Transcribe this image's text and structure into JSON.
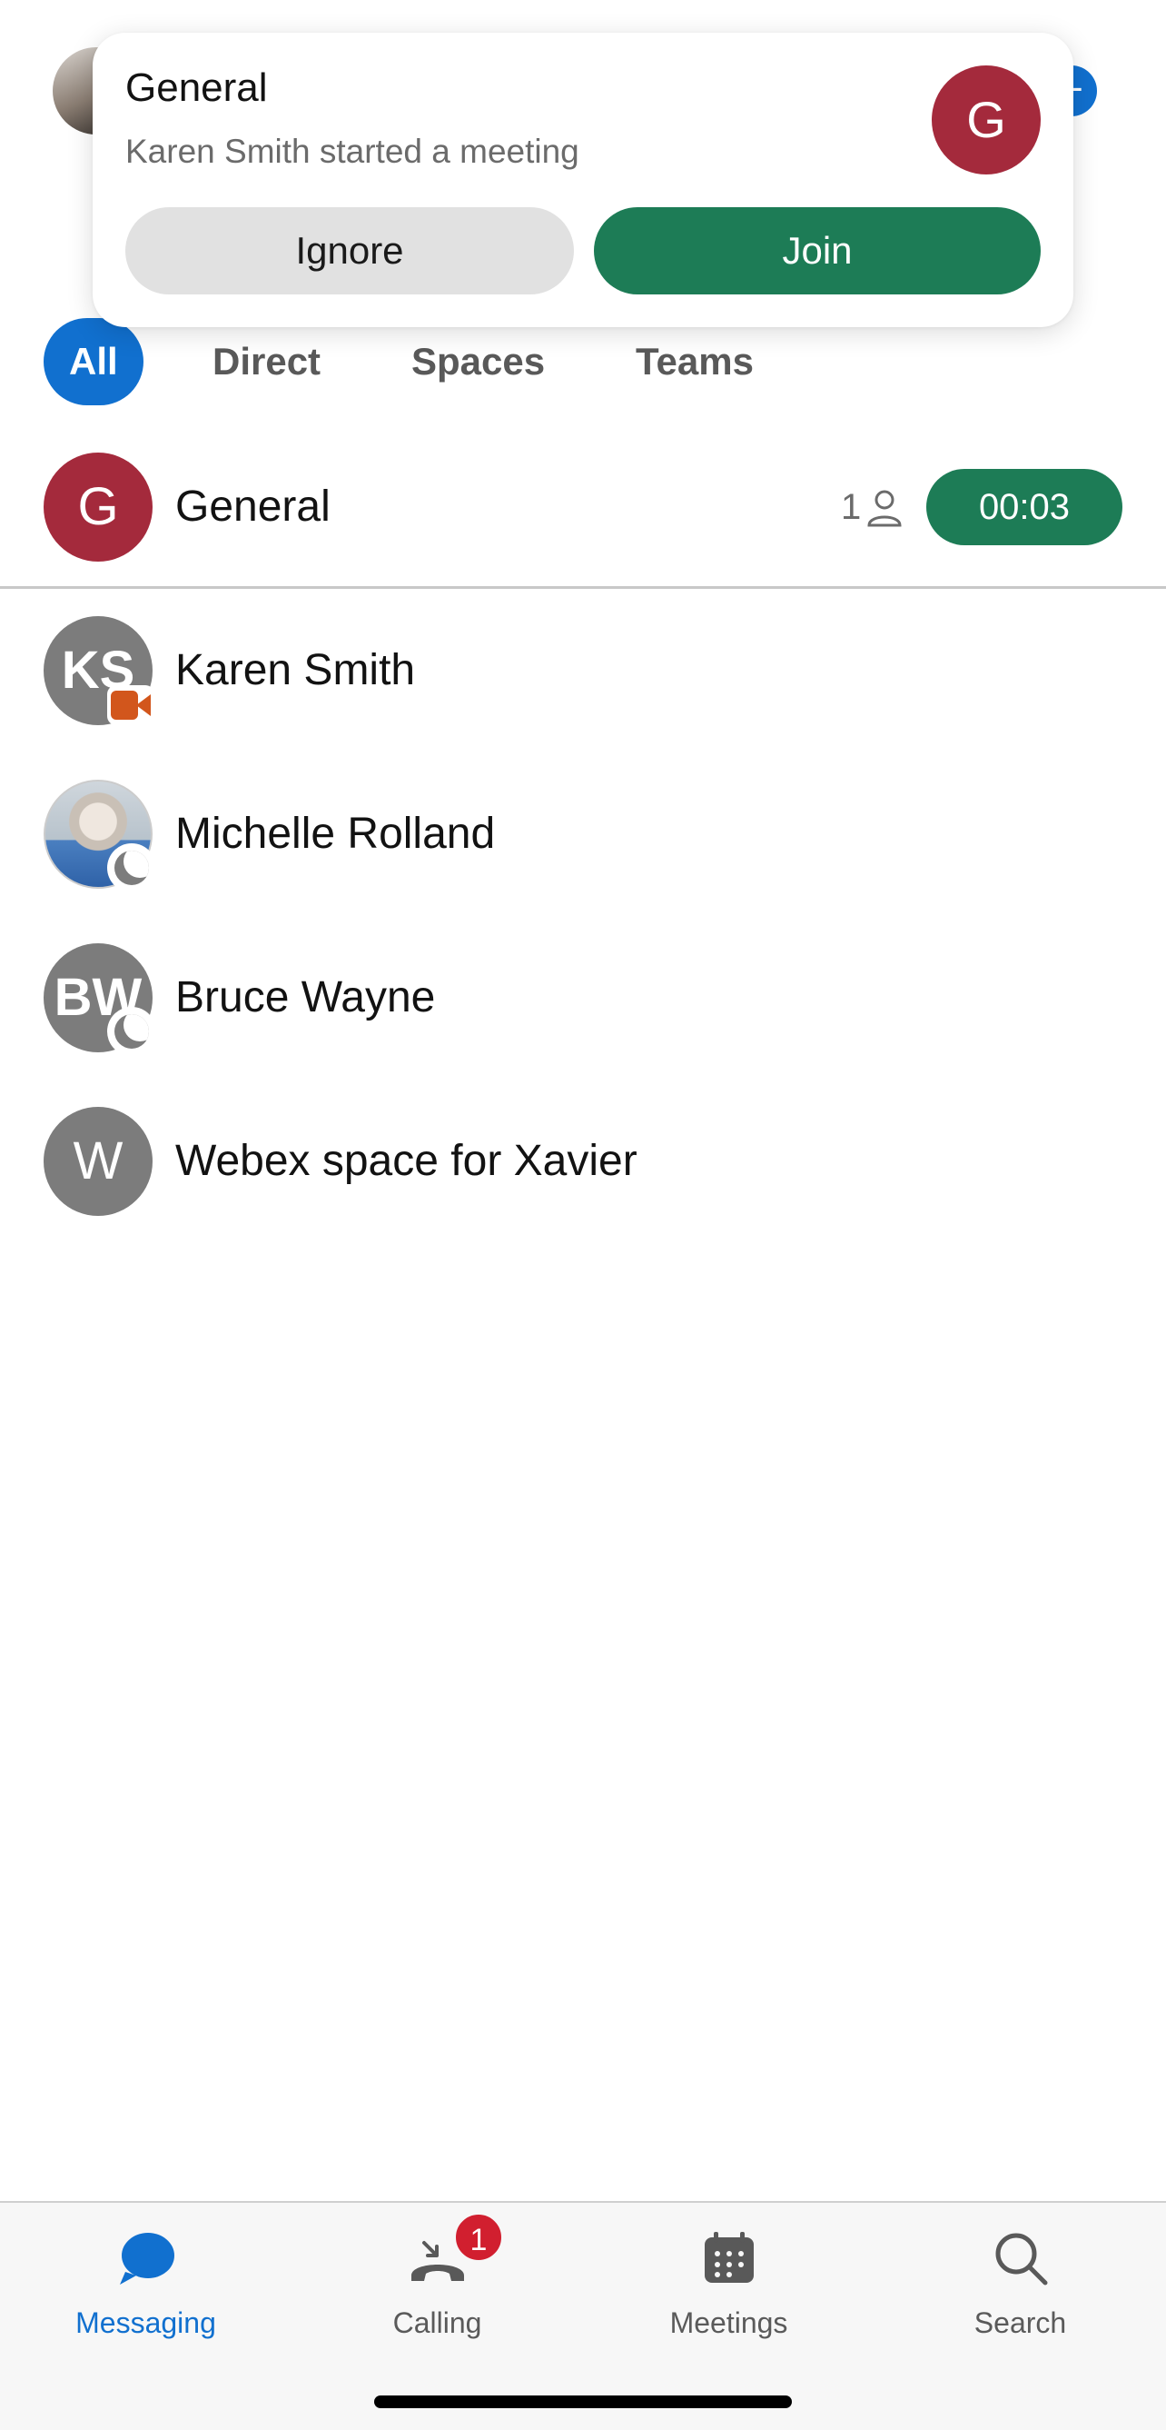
{
  "banner": {
    "title": "General",
    "subtitle": "Karen Smith started a meeting",
    "avatar_initial": "G",
    "ignore_label": "Ignore",
    "join_label": "Join"
  },
  "filters": [
    {
      "label": "All",
      "active": true
    },
    {
      "label": "Direct",
      "active": false
    },
    {
      "label": "Spaces",
      "active": false
    },
    {
      "label": "Teams",
      "active": false
    }
  ],
  "conversations": [
    {
      "name": "General",
      "initials": "G",
      "participants": "1",
      "timer": "00:03",
      "in_meeting": true
    },
    {
      "name": "Karen Smith",
      "initials": "KS",
      "presence": "camera-icon"
    },
    {
      "name": "Michelle Rolland",
      "initials": "",
      "presence": "moon-icon"
    },
    {
      "name": "Bruce Wayne",
      "initials": "BW",
      "presence": "moon-icon"
    },
    {
      "name": "Webex space for Xavier",
      "initials": "W"
    }
  ],
  "tabs": [
    {
      "label": "Messaging",
      "icon": "chat-bubble-icon",
      "active": true
    },
    {
      "label": "Calling",
      "icon": "phone-icon",
      "badge": "1"
    },
    {
      "label": "Meetings",
      "icon": "calendar-icon"
    },
    {
      "label": "Search",
      "icon": "search-icon"
    }
  ],
  "colors": {
    "accent": "#1170cf",
    "join_green": "#1d7c56",
    "space_red": "#a42a3c",
    "badge_red": "#d11f2f",
    "presence_orange": "#d2561c"
  }
}
